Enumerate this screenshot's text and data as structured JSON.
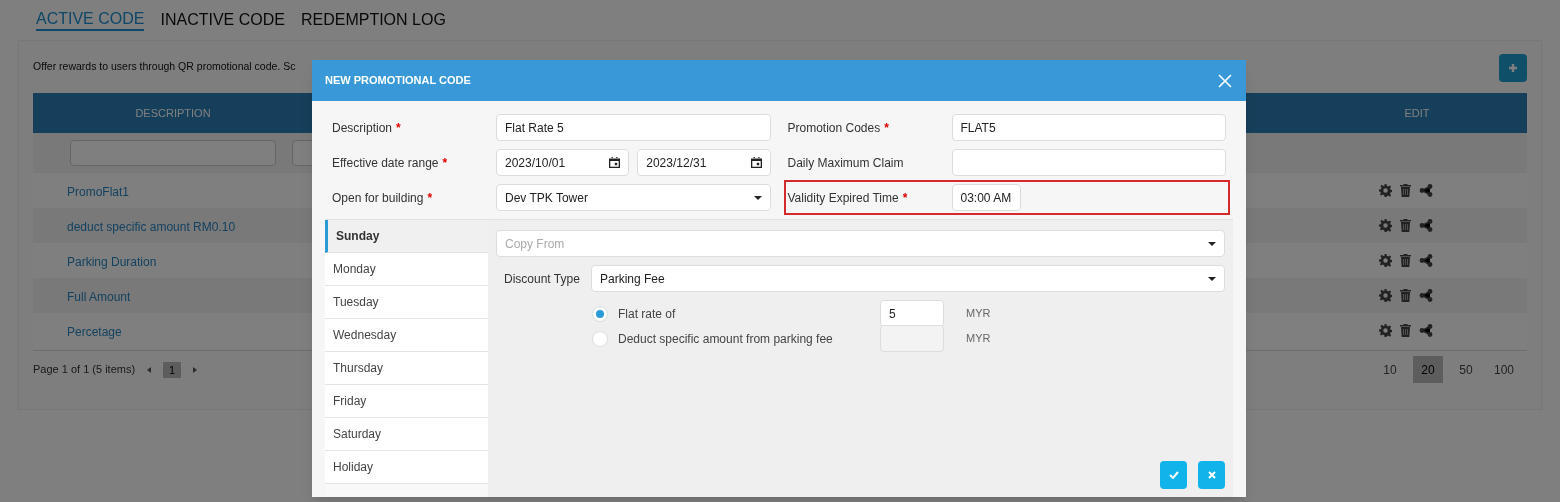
{
  "tabs": [
    {
      "label": "ACTIVE CODE",
      "selected": true
    },
    {
      "label": "INACTIVE CODE",
      "selected": false
    },
    {
      "label": "REDEMPTION LOG",
      "selected": false
    }
  ],
  "intro_text": "Offer rewards to users through QR promotional code. Sc",
  "table": {
    "columns": [
      "DESCRIPTION",
      "EDIT"
    ],
    "rows": [
      {
        "description": "PromoFlat1"
      },
      {
        "description": "deduct specific amount RM0.10"
      },
      {
        "description": "Parking Duration"
      },
      {
        "description": "Full Amount"
      },
      {
        "description": "Percetage"
      }
    ]
  },
  "pagination": {
    "summary": "Page 1 of 1 (5 items)",
    "pages": [
      {
        "label": "1",
        "selected": true
      }
    ],
    "page_sizes": [
      {
        "label": "10",
        "selected": false
      },
      {
        "label": "20",
        "selected": true
      },
      {
        "label": "50",
        "selected": false
      },
      {
        "label": "100",
        "selected": false
      }
    ]
  },
  "modal": {
    "title": "NEW PROMOTIONAL CODE",
    "form_rows": [
      [
        {
          "label": "Description",
          "required_mark": "*",
          "inputs": [
            {
              "kind": "text",
              "value": "Flat Rate 5"
            }
          ]
        },
        {
          "label": "Promotion Codes",
          "required_mark": "*",
          "inputs": [
            {
              "kind": "text",
              "value": "FLAT5"
            }
          ]
        }
      ],
      [
        {
          "label": "Effective date range",
          "required_mark": "*",
          "inputs": [
            {
              "kind": "date",
              "value": "2023/10/01"
            },
            {
              "kind": "date",
              "value": "2023/12/31"
            }
          ]
        },
        {
          "label": "Daily Maximum Claim",
          "inputs": [
            {
              "kind": "text"
            }
          ]
        }
      ],
      [
        {
          "label": "Open for building",
          "required_mark": "*",
          "inputs": [
            {
              "kind": "select",
              "value": "Dev TPK Tower"
            }
          ]
        },
        {
          "label": "Validity Expired Time",
          "required_mark": "*",
          "highlighted": true,
          "inputs": [
            {
              "kind": "time",
              "value": "03:00 AM"
            }
          ]
        }
      ]
    ],
    "days": [
      {
        "label": "Sunday",
        "selected": true
      },
      {
        "label": "Monday",
        "selected": false
      },
      {
        "label": "Tuesday",
        "selected": false
      },
      {
        "label": "Wednesday",
        "selected": false
      },
      {
        "label": "Thursday",
        "selected": false
      },
      {
        "label": "Friday",
        "selected": false
      },
      {
        "label": "Saturday",
        "selected": false
      },
      {
        "label": "Holiday",
        "selected": false
      }
    ],
    "copy_from": {
      "placeholder": "Copy From"
    },
    "discount_type": {
      "label": "Discount Type",
      "value": "Parking Fee"
    },
    "options": [
      {
        "label": "Flat rate of",
        "selected": true,
        "amount": "5",
        "disabled": false,
        "unit": "MYR"
      },
      {
        "label": "Deduct specific amount from parking fee",
        "selected": false,
        "disabled": true,
        "unit": "MYR"
      }
    ]
  }
}
